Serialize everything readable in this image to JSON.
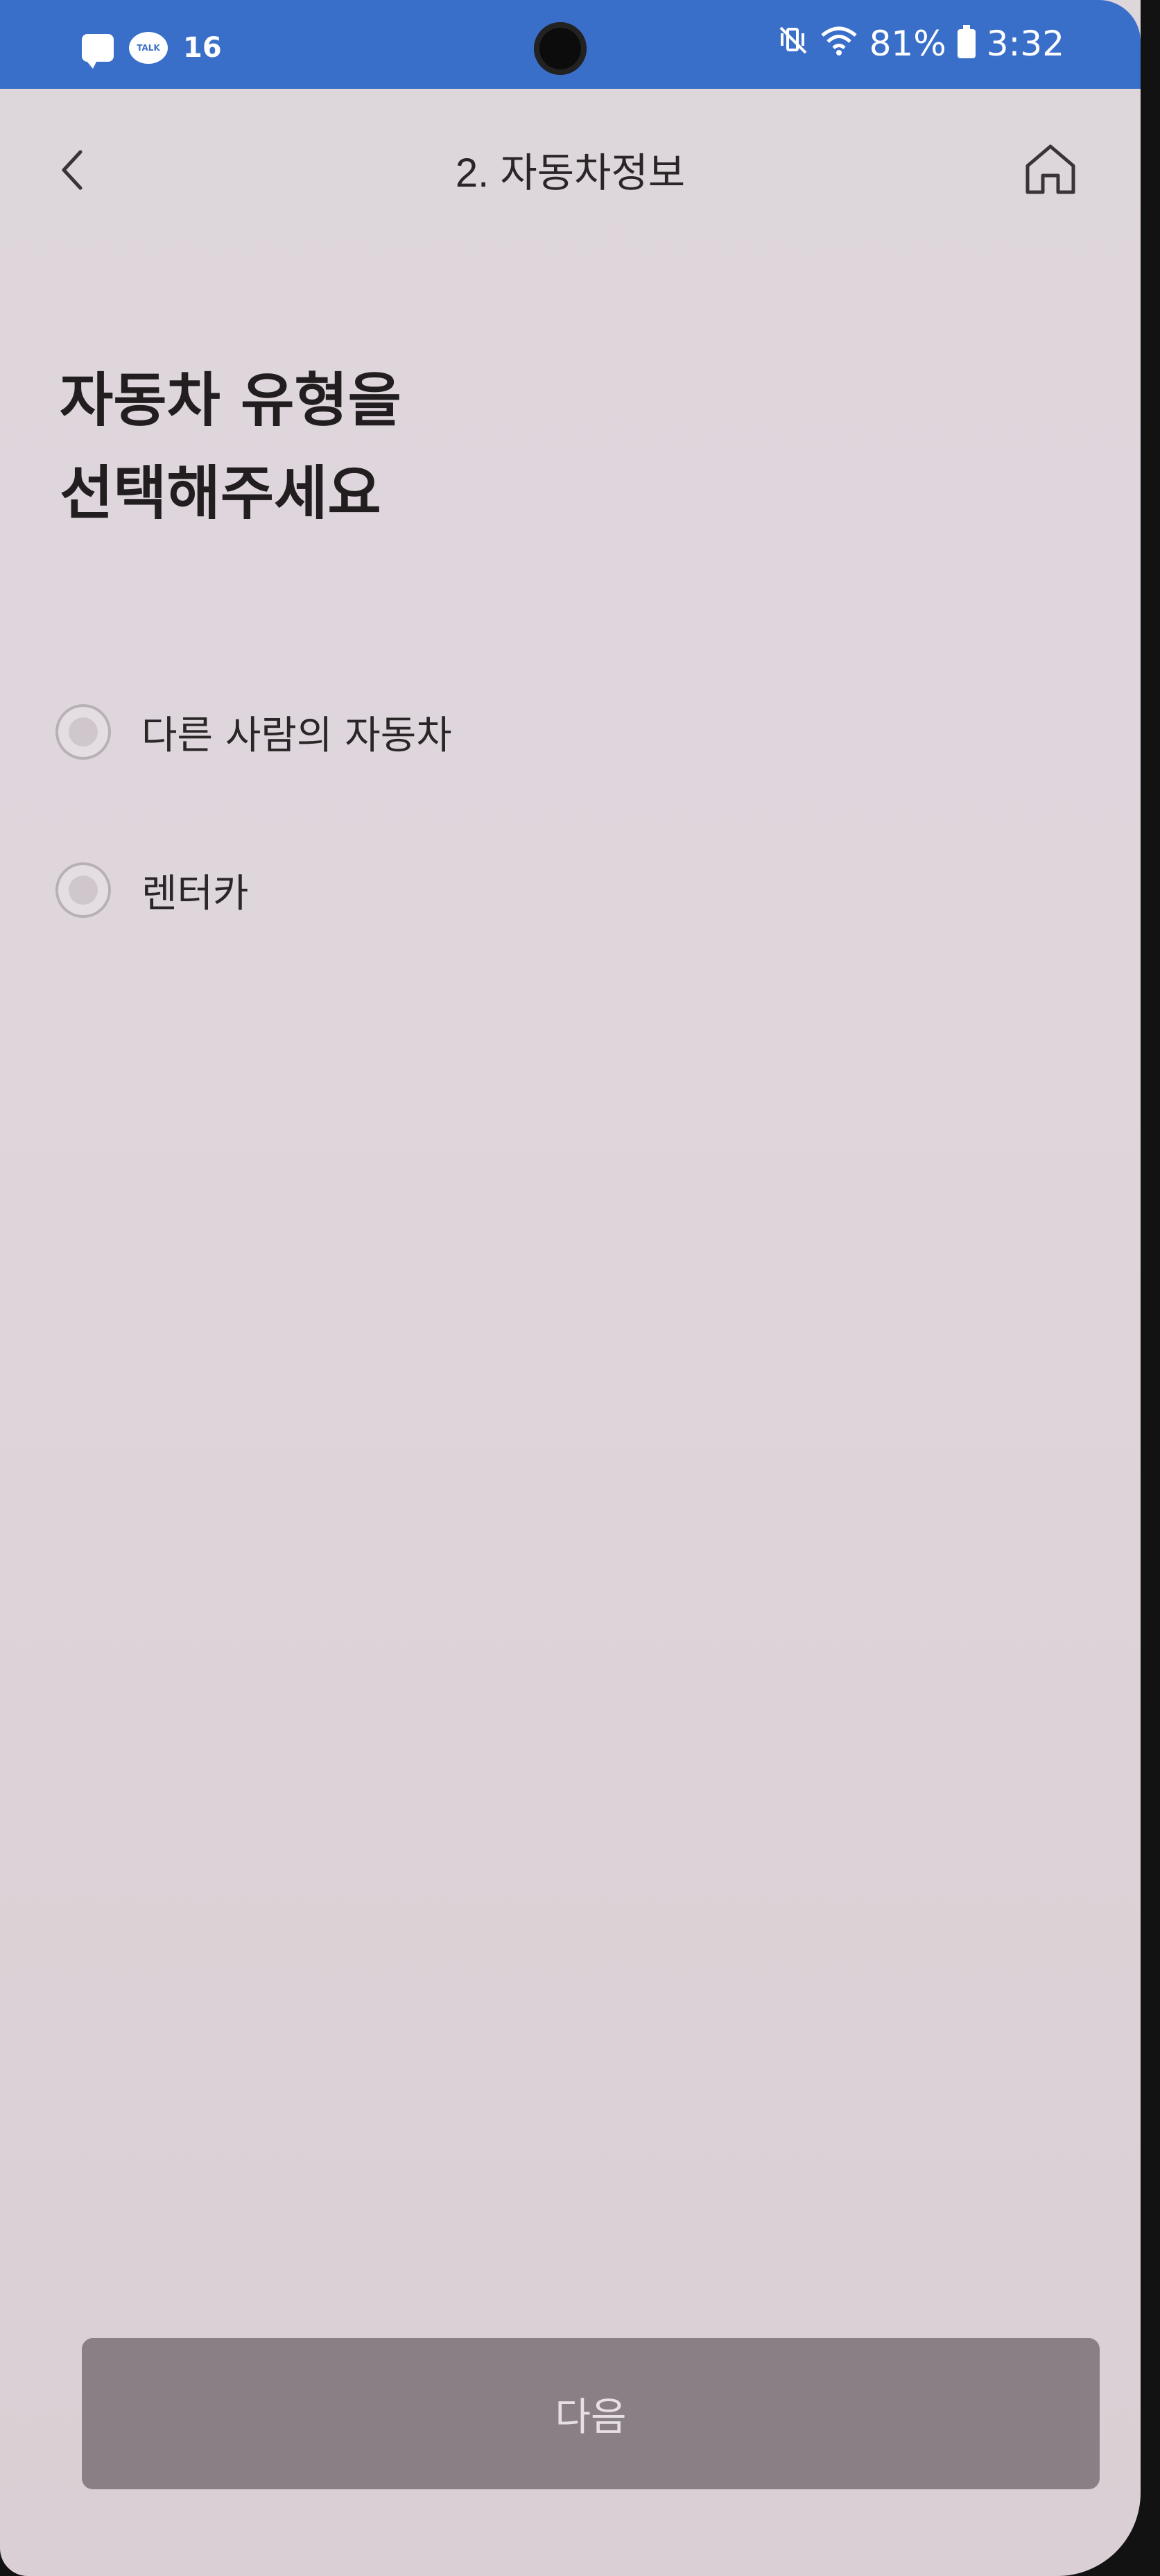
{
  "status_bar": {
    "notification_count": "16",
    "talk_badge": "TALK",
    "battery_percent": "81%",
    "time": "3:32",
    "icons": [
      "message-icon",
      "kakaotalk-icon",
      "vibrate-icon",
      "wifi-icon",
      "battery-icon"
    ]
  },
  "header": {
    "title": "2. 자동차정보",
    "back_icon": "chevron-left-icon",
    "home_icon": "home-icon"
  },
  "main": {
    "heading_line1": "자동차 유형을",
    "heading_line2": "선택해주세요",
    "options": [
      {
        "label": "다른 사람의 자동차",
        "selected": false
      },
      {
        "label": "렌터카",
        "selected": false
      }
    ]
  },
  "footer": {
    "next_label": "다음",
    "enabled": false
  },
  "colors": {
    "status_bar": "#3a6fc9",
    "background": "#ddd6db",
    "button_disabled": "#8b7f86",
    "text": "#2a2527"
  }
}
